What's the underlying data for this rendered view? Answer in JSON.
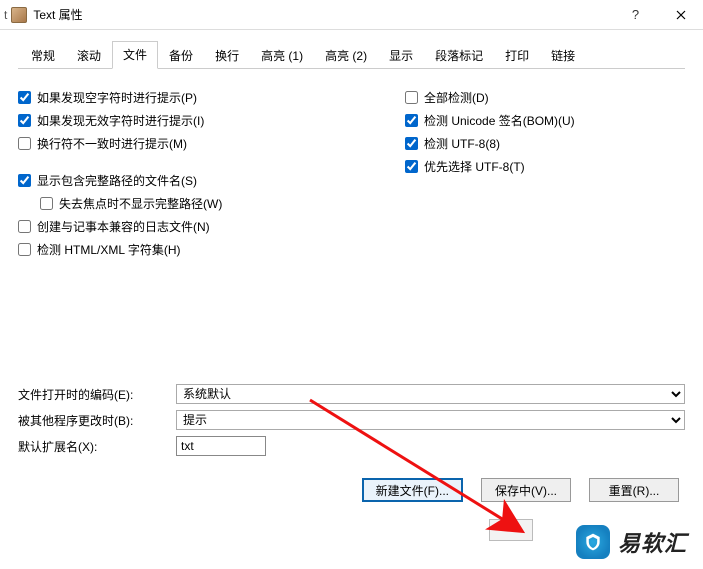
{
  "window": {
    "edge_char": "t",
    "title": "Text 属性",
    "help": "?",
    "close": "×"
  },
  "tabs": [
    {
      "id": "general",
      "label": "常规"
    },
    {
      "id": "scroll",
      "label": "滚动"
    },
    {
      "id": "file",
      "label": "文件"
    },
    {
      "id": "backup",
      "label": "备份"
    },
    {
      "id": "wrap",
      "label": "换行"
    },
    {
      "id": "hl1",
      "label": "高亮 (1)"
    },
    {
      "id": "hl2",
      "label": "高亮 (2)"
    },
    {
      "id": "display",
      "label": "显示"
    },
    {
      "id": "para",
      "label": "段落标记"
    },
    {
      "id": "print",
      "label": "打印"
    },
    {
      "id": "link",
      "label": "链接"
    }
  ],
  "active_tab": "file",
  "left": {
    "prompt_nullchar": {
      "checked": true,
      "label": "如果发现空字符时进行提示(P)"
    },
    "prompt_invalid": {
      "checked": true,
      "label": "如果发现无效字符时进行提示(I)"
    },
    "prompt_eol": {
      "checked": false,
      "label": "换行符不一致时进行提示(M)"
    },
    "show_fullpath": {
      "checked": true,
      "label": "显示包含完整路径的文件名(S)"
    },
    "hide_path_unfocus": {
      "checked": false,
      "label": "失去焦点时不显示完整路径(W)"
    },
    "notepad_compat": {
      "checked": false,
      "label": "创建与记事本兼容的日志文件(N)"
    },
    "detect_htmlxml": {
      "checked": false,
      "label": "检测 HTML/XML 字符集(H)"
    }
  },
  "right": {
    "detect_all": {
      "checked": false,
      "label": "全部检测(D)"
    },
    "detect_bom": {
      "checked": true,
      "label": "检测 Unicode 签名(BOM)(U)"
    },
    "detect_utf8": {
      "checked": true,
      "label": "检测 UTF-8(8)"
    },
    "prefer_utf8": {
      "checked": true,
      "label": "优先选择 UTF-8(T)"
    }
  },
  "form": {
    "encoding_label": "文件打开时的编码(E):",
    "encoding_value": "系统默认",
    "changed_label": "被其他程序更改时(B):",
    "changed_value": "提示",
    "ext_label": "默认扩展名(X):",
    "ext_value": "txt"
  },
  "buttons": {
    "newfile": "新建文件(F)...",
    "saving": "保存中(V)...",
    "reset": "重置(R)..."
  },
  "logo_text": "易软汇"
}
